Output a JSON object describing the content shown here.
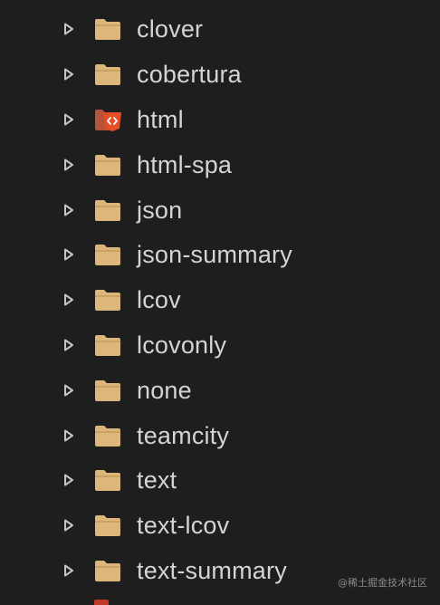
{
  "colors": {
    "background": "#1e1e1e",
    "text": "#d4d4d4",
    "folder": "#dcb67a",
    "folder_tab": "#c9a364",
    "html_badge": "#e44d26",
    "html_badge_code": "#ffffff",
    "chevron": "#c5c5c5"
  },
  "tree": {
    "items": [
      {
        "label": "clover",
        "icon": "folder-icon"
      },
      {
        "label": "cobertura",
        "icon": "folder-icon"
      },
      {
        "label": "html",
        "icon": "html-folder-icon"
      },
      {
        "label": "html-spa",
        "icon": "folder-icon"
      },
      {
        "label": "json",
        "icon": "folder-icon"
      },
      {
        "label": "json-summary",
        "icon": "folder-icon"
      },
      {
        "label": "lcov",
        "icon": "folder-icon"
      },
      {
        "label": "lcovonly",
        "icon": "folder-icon"
      },
      {
        "label": "none",
        "icon": "folder-icon"
      },
      {
        "label": "teamcity",
        "icon": "folder-icon"
      },
      {
        "label": "text",
        "icon": "folder-icon"
      },
      {
        "label": "text-lcov",
        "icon": "folder-icon"
      },
      {
        "label": "text-summary",
        "icon": "folder-icon"
      }
    ]
  },
  "watermark": {
    "text": "@稀土掘金技术社区"
  }
}
